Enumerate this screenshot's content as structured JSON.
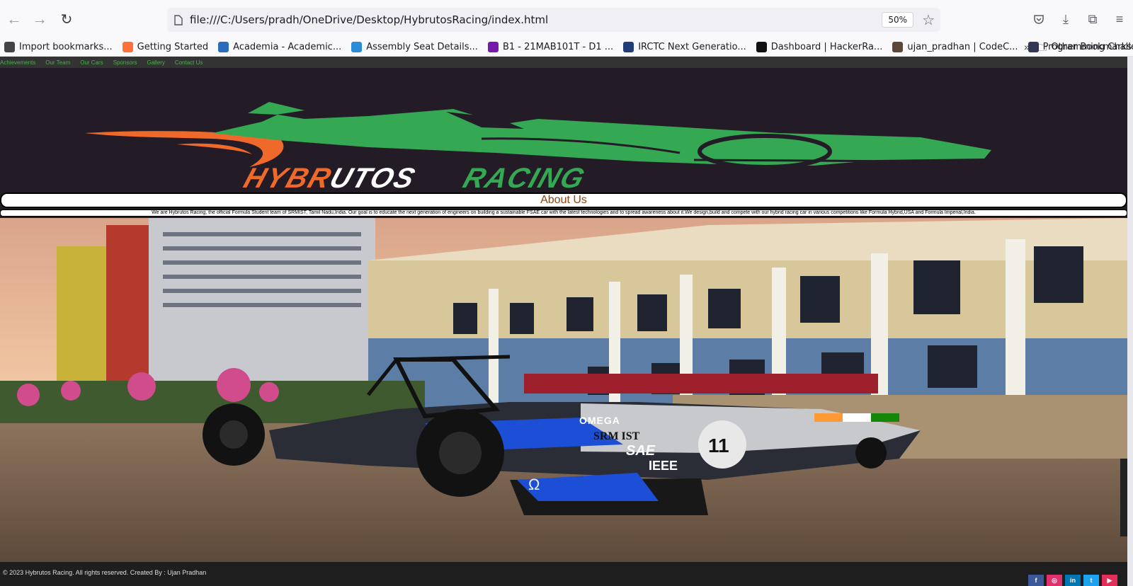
{
  "browser": {
    "url": "file:///C:/Users/pradh/OneDrive/Desktop/HybrutosRacing/index.html",
    "zoom": "50%",
    "bookmarks": [
      {
        "label": "Import bookmarks...",
        "icon": "import-icon",
        "color": "#444"
      },
      {
        "label": "Getting Started",
        "icon": "firefox-icon",
        "color": "#ff7139"
      },
      {
        "label": "Academia - Academic...",
        "icon": "academia-icon",
        "color": "#2a6ebb"
      },
      {
        "label": "Assembly Seat Details...",
        "icon": "assembly-icon",
        "color": "#2a8cd6"
      },
      {
        "label": "B1 - 21MAB101T - D1 ...",
        "icon": "onenote-icon",
        "color": "#7719aa"
      },
      {
        "label": "IRCTC Next Generatio...",
        "icon": "irctc-icon",
        "color": "#213d77"
      },
      {
        "label": "Dashboard | HackerRa...",
        "icon": "hackerrank-icon",
        "color": "#111"
      },
      {
        "label": "ujan_pradhan | CodeC...",
        "icon": "codechef-icon",
        "color": "#5b4638"
      },
      {
        "label": "Programming Challen...",
        "icon": "hackerearth-icon",
        "color": "#323754"
      }
    ],
    "other_bookmarks": "Other Bookmarks"
  },
  "site": {
    "nav": [
      "Achievements",
      "Our Team",
      "Our Cars",
      "Sponsors",
      "Gallery",
      "Contact Us"
    ],
    "logo_text": {
      "part1": "HYBR",
      "part2": "UTOS",
      "part3": "RACING"
    },
    "about_title": "About Us",
    "about_text": "We are Hybrutos Racing, the official Formula Student team of SRMIST, Tamil Nadu,India. Our goal is to educate the next generation of engineers on building a sustainable FSAE car with the latest technologies and to spread awareness about it.We design,build and compete with our hybrid racing car in various competitions like Formula Hybrid,USA and Formula Imperial,India.",
    "car_labels": {
      "sponsor": "OMEGA",
      "team": "SRM IST",
      "sae": "SAE",
      "ieee": "IEEE",
      "number": "11",
      "omega_symbol": "Ω"
    },
    "footer": "© 2023 Hybrutos Racing. All rights reserved. Created By : Ujan Pradhan",
    "social": [
      {
        "label": "f",
        "name": "facebook-icon",
        "color": "#3b5998"
      },
      {
        "label": "◎",
        "name": "instagram-icon",
        "color": "#e1306c"
      },
      {
        "label": "in",
        "name": "linkedin-icon",
        "color": "#0077b5"
      },
      {
        "label": "t",
        "name": "twitter-icon",
        "color": "#1da1f2"
      },
      {
        "label": "▶",
        "name": "youtube-icon",
        "color": "#e52d5a"
      }
    ]
  }
}
